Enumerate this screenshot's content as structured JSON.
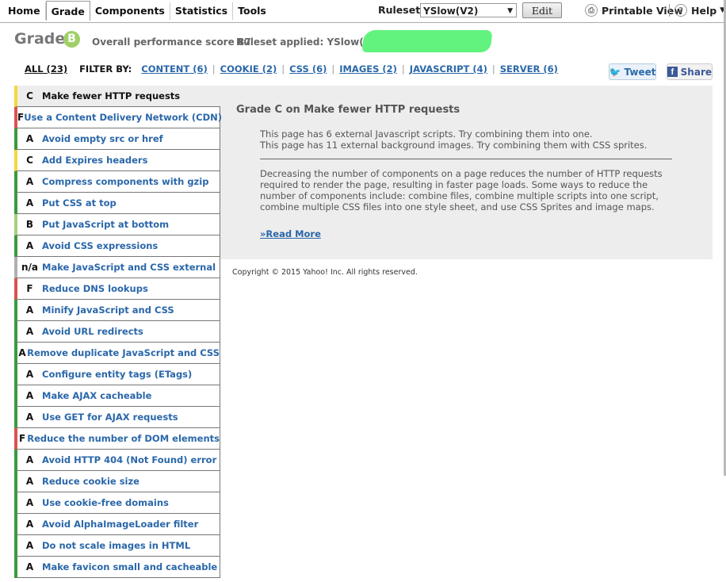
{
  "tabs": [
    {
      "label": "Home"
    },
    {
      "label": "Grade"
    },
    {
      "label": "Components"
    },
    {
      "label": "Statistics"
    },
    {
      "label": "Tools"
    }
  ],
  "toolbar": {
    "rulesets_label": "Rulesets",
    "rulesets_value": "YSlow(V2)",
    "edit_label": "Edit",
    "printable_label": "Printable View",
    "help_label": "Help"
  },
  "grade": {
    "title": "Grade",
    "letter": "B",
    "score_text": "Overall performance score 87",
    "ruleset_text": "Ruleset applied: YSlow(V2)"
  },
  "filter": {
    "all_label": "ALL (23)",
    "by_label": "FILTER BY:",
    "links": [
      "CONTENT (6)",
      "COOKIE (2)",
      "CSS (6)",
      "IMAGES (2)",
      "JAVASCRIPT (4)",
      "SERVER (6)"
    ]
  },
  "social": {
    "tweet_label": "Tweet",
    "share_label": "Share"
  },
  "colors": {
    "grade_a": "#3a9a3a",
    "grade_b": "#a6d07c",
    "grade_c": "#f2d83c",
    "grade_f": "#d9534f",
    "grade_na": "#b0b0b0",
    "link": "#2a67a9"
  },
  "rules": [
    {
      "grade": "C",
      "name": "Make fewer HTTP requests",
      "color": "#f2d83c"
    },
    {
      "grade": "F",
      "name": "Use a Content Delivery Network (CDN)",
      "color": "#d9534f"
    },
    {
      "grade": "A",
      "name": "Avoid empty src or href",
      "color": "#3a9a3a"
    },
    {
      "grade": "C",
      "name": "Add Expires headers",
      "color": "#f2d83c"
    },
    {
      "grade": "A",
      "name": "Compress components with gzip",
      "color": "#3a9a3a"
    },
    {
      "grade": "A",
      "name": "Put CSS at top",
      "color": "#3a9a3a"
    },
    {
      "grade": "B",
      "name": "Put JavaScript at bottom",
      "color": "#a6d07c"
    },
    {
      "grade": "A",
      "name": "Avoid CSS expressions",
      "color": "#3a9a3a"
    },
    {
      "grade": "n/a",
      "name": "Make JavaScript and CSS external",
      "color": "#b0b0b0"
    },
    {
      "grade": "F",
      "name": "Reduce DNS lookups",
      "color": "#d9534f"
    },
    {
      "grade": "A",
      "name": "Minify JavaScript and CSS",
      "color": "#3a9a3a"
    },
    {
      "grade": "A",
      "name": "Avoid URL redirects",
      "color": "#3a9a3a"
    },
    {
      "grade": "A",
      "name": "Remove duplicate JavaScript and CSS",
      "color": "#3a9a3a"
    },
    {
      "grade": "A",
      "name": "Configure entity tags (ETags)",
      "color": "#3a9a3a"
    },
    {
      "grade": "A",
      "name": "Make AJAX cacheable",
      "color": "#3a9a3a"
    },
    {
      "grade": "A",
      "name": "Use GET for AJAX requests",
      "color": "#3a9a3a"
    },
    {
      "grade": "F",
      "name": "Reduce the number of DOM elements",
      "color": "#d9534f"
    },
    {
      "grade": "A",
      "name": "Avoid HTTP 404 (Not Found) error",
      "color": "#3a9a3a"
    },
    {
      "grade": "A",
      "name": "Reduce cookie size",
      "color": "#3a9a3a"
    },
    {
      "grade": "A",
      "name": "Use cookie-free domains",
      "color": "#3a9a3a"
    },
    {
      "grade": "A",
      "name": "Avoid AlphaImageLoader filter",
      "color": "#3a9a3a"
    },
    {
      "grade": "A",
      "name": "Do not scale images in HTML",
      "color": "#3a9a3a"
    },
    {
      "grade": "A",
      "name": "Make favicon small and cacheable",
      "color": "#3a9a3a"
    }
  ],
  "detail": {
    "title": "Grade C on Make fewer HTTP requests",
    "line1": "This page has 6 external Javascript scripts. Try combining them into one.",
    "line2": "This page has 11 external background images. Try combining them with CSS sprites.",
    "description": "Decreasing the number of components on a page reduces the number of HTTP requests required to render the page, resulting in faster page loads. Some ways to reduce the number of components include: combine files, combine multiple scripts into one script, combine multiple CSS files into one style sheet, and use CSS Sprites and image maps.",
    "read_more": "»Read More"
  },
  "footer": {
    "copyright": "Copyright © 2015 Yahoo! Inc. All rights reserved."
  }
}
